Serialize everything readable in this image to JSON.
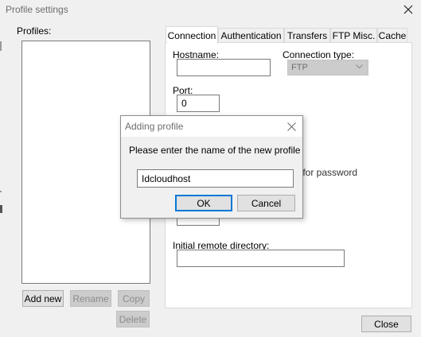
{
  "window": {
    "title": "Profile settings",
    "close_icon": "close-icon"
  },
  "profiles": {
    "label": "Profiles:",
    "items": [],
    "buttons": {
      "add_new": "Add new",
      "rename": "Rename",
      "copy": "Copy",
      "delete": "Delete"
    }
  },
  "tabs": [
    {
      "label": "Connection",
      "active": true
    },
    {
      "label": "Authentication",
      "active": false
    },
    {
      "label": "Transfers",
      "active": false
    },
    {
      "label": "FTP Misc.",
      "active": false
    },
    {
      "label": "Cache",
      "active": false
    }
  ],
  "connection": {
    "hostname_label": "Hostname:",
    "hostname_value": "",
    "type_label": "Connection type:",
    "type_value": "FTP",
    "port_label": "Port:",
    "port_value": "0",
    "partial_password_text": "k for password",
    "initial_dir_label": "Initial remote directory:",
    "initial_dir_value": ""
  },
  "footer": {
    "close_label": "Close"
  },
  "dialog": {
    "title": "Adding profile",
    "prompt": "Please enter the name of the new profile",
    "input_value": "Idcloudhost",
    "ok_label": "OK",
    "cancel_label": "Cancel"
  }
}
